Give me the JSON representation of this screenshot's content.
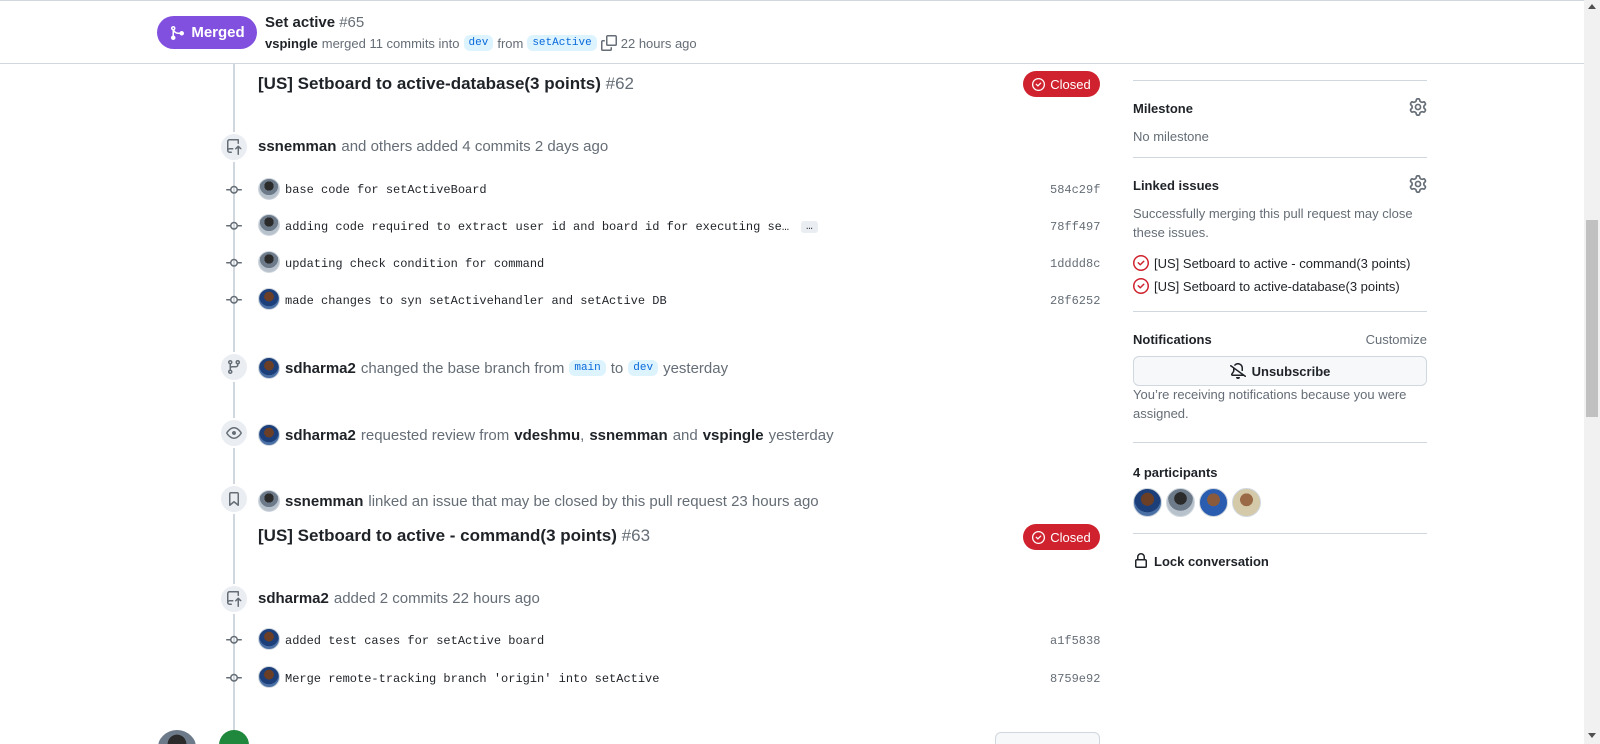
{
  "header": {
    "status_label": "Merged",
    "title": "Set active",
    "number": "#65",
    "merged_by": "vspingle",
    "merged_text": "merged 11 commits into",
    "base_branch": "dev",
    "from_text": "from",
    "head_branch": "setActive",
    "time": "22 hours ago"
  },
  "timeline": {
    "linked_issue_1": {
      "title": "[US] Setboard to active-database(3 points)",
      "number": "#62",
      "status": "Closed"
    },
    "commits_event_1": {
      "user": "ssnemman",
      "text": "and others added 4 commits 2 days ago",
      "commits": [
        {
          "message": "base code for setActiveBoard",
          "sha": "584c29f",
          "avatar": "av-a"
        },
        {
          "message": "adding code required to extract user id and board id for executing se…",
          "sha": "78ff497",
          "avatar": "av-a",
          "ellipsis": "…"
        },
        {
          "message": "updating check condition for command",
          "sha": "1dddd8c",
          "avatar": "av-a"
        },
        {
          "message": "made changes to syn setActivehandler and setActive DB",
          "sha": "28f6252",
          "avatar": "av-b"
        }
      ]
    },
    "branch_event": {
      "user": "sdharma2",
      "text_1": "changed the base branch from",
      "from_branch": "main",
      "text_2": "to",
      "to_branch": "dev",
      "time": "yesterday"
    },
    "review_event": {
      "user": "sdharma2",
      "text": "requested review from",
      "reviewer_1": "vdeshmu",
      "sep": ",",
      "reviewer_2": "ssnemman",
      "and": "and",
      "reviewer_3": "vspingle",
      "time": "yesterday"
    },
    "link_event": {
      "user": "ssnemman",
      "text": "linked an issue that may be closed by this pull request 23 hours ago"
    },
    "linked_issue_2": {
      "title": "[US] Setboard to active - command(3 points)",
      "number": "#63",
      "status": "Closed"
    },
    "commits_event_2": {
      "user": "sdharma2",
      "text": "added 2 commits 22 hours ago",
      "commits": [
        {
          "message": "added test cases for setActive board",
          "sha": "a1f5838",
          "avatar": "av-b"
        },
        {
          "message": "Merge remote-tracking branch 'origin' into setActive",
          "sha": "8759e92",
          "avatar": "av-b"
        }
      ]
    }
  },
  "sidebar": {
    "milestone": {
      "heading": "Milestone",
      "value": "No milestone"
    },
    "linked_issues": {
      "heading": "Linked issues",
      "description": "Successfully merging this pull request may close these issues.",
      "items": [
        "[US] Setboard to active - command(3 points)",
        "[US] Setboard to active-database(3 points)"
      ]
    },
    "notifications": {
      "heading": "Notifications",
      "customize": "Customize",
      "button": "Unsubscribe",
      "description": "You’re receiving notifications because you were assigned."
    },
    "participants": {
      "heading": "4 participants"
    },
    "lock": {
      "label": "Lock conversation"
    }
  },
  "colors": {
    "merged": "#8250df",
    "closed": "#cf222e",
    "link": "#0969da",
    "muted": "#656d76"
  }
}
